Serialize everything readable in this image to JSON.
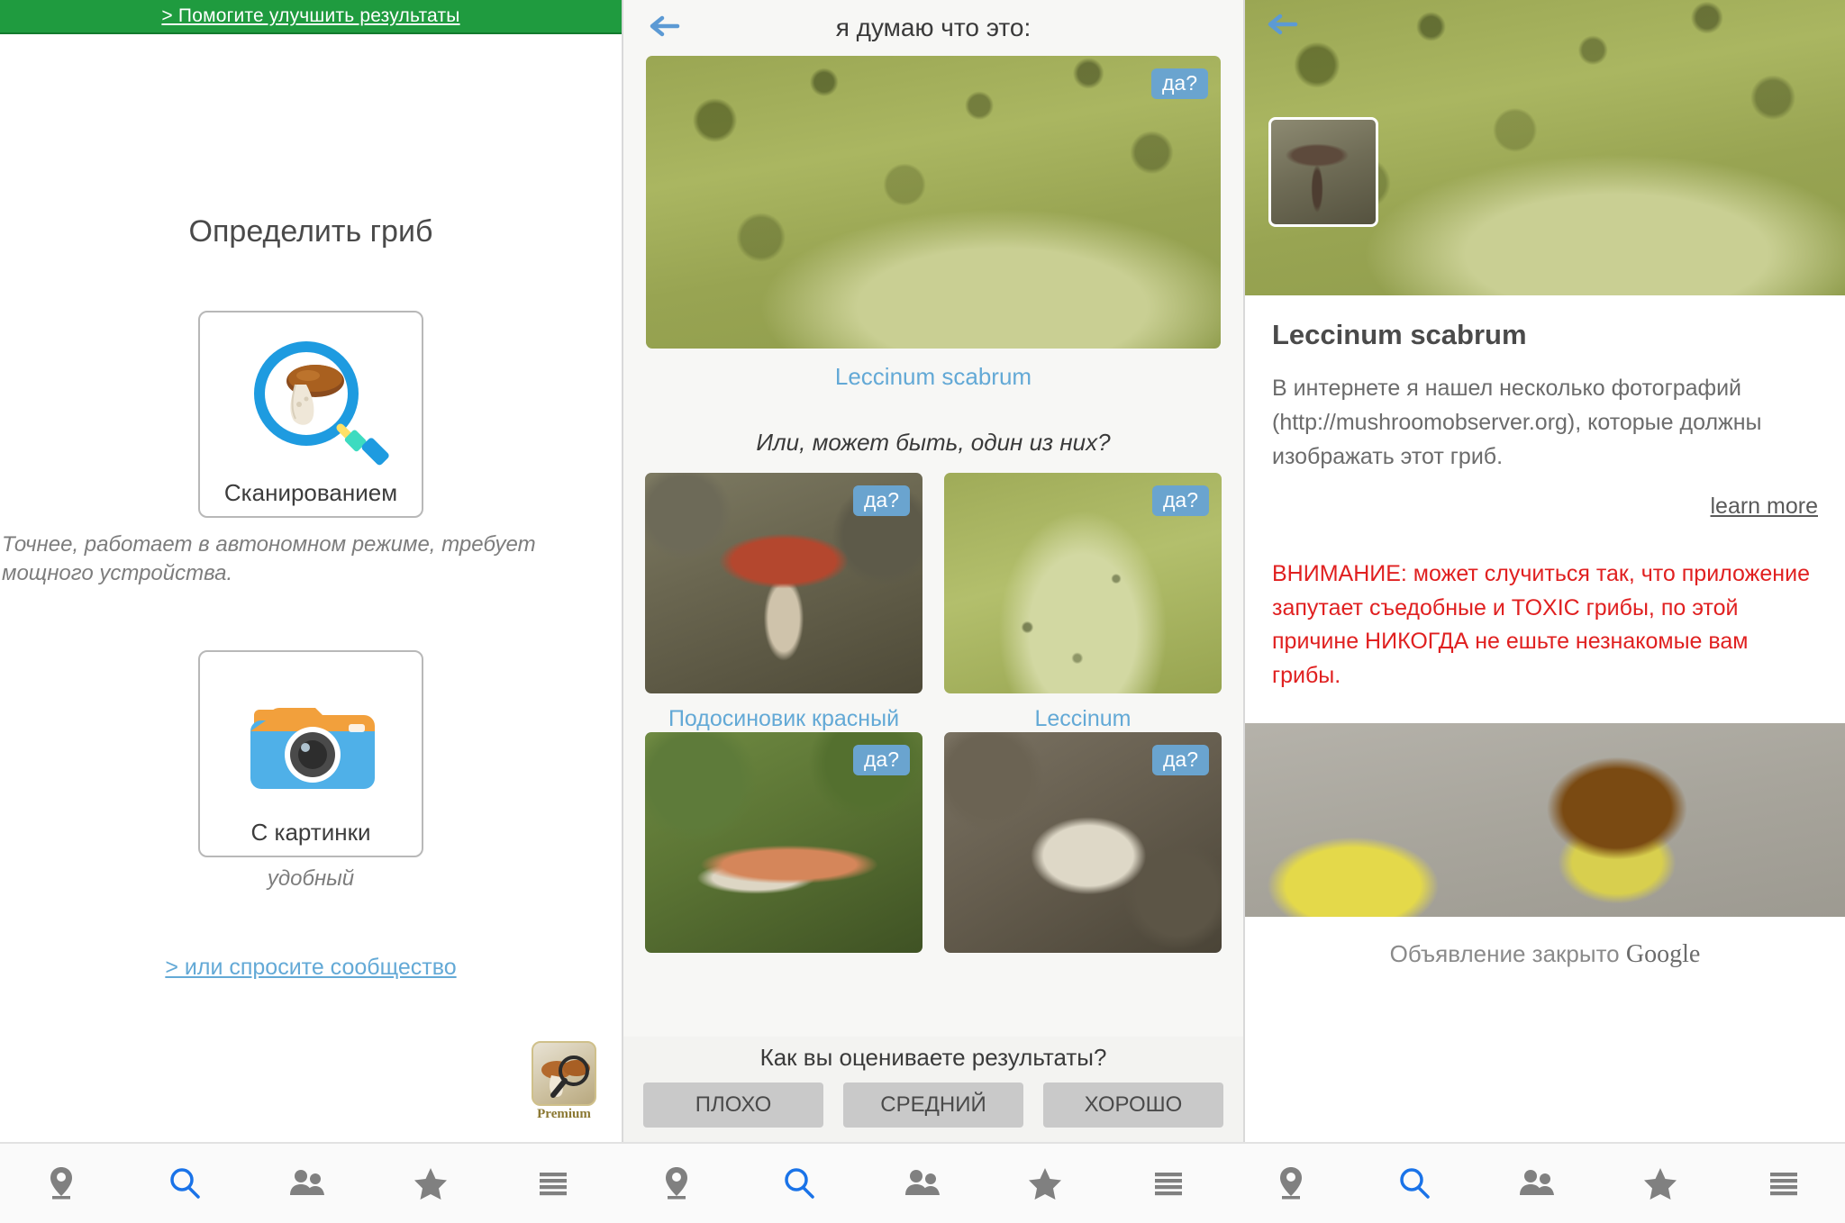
{
  "left": {
    "banner": {
      "text": "> Помогите улучшить результаты"
    },
    "title": "Определить гриб",
    "scan_card": {
      "label": "Сканированием",
      "icon": "mushroom-magnifier-icon"
    },
    "scan_note": "Точнее, работает в автономном режиме, требует мощного устройства.",
    "picture_card": {
      "label": "С картинки",
      "icon": "camera-icon"
    },
    "picture_note": "удобный",
    "community_link": "> или спросите сообщество",
    "premium": {
      "label": "Premium",
      "icon": "premium-app-icon"
    }
  },
  "middle": {
    "back_icon": "back-arrow-icon",
    "header_title": "я думаю что это:",
    "primary": {
      "caption": "Leccinum scabrum",
      "badge": "да?"
    },
    "alt_question": "Или, может быть, один из них?",
    "alternatives": [
      {
        "caption": "Подосиновик красный",
        "badge": "да?"
      },
      {
        "caption": "Leccinum",
        "badge": "да?"
      },
      {
        "caption": "",
        "badge": "да?"
      },
      {
        "caption": "",
        "badge": "да?"
      }
    ],
    "rating": {
      "question": "Как вы оцениваете результаты?",
      "buttons": [
        "ПЛОХО",
        "СРЕДНИЙ",
        "ХОРОШО"
      ]
    }
  },
  "right": {
    "back_icon": "back-arrow-icon",
    "species_name": "Leccinum scabrum",
    "description": "В интернете я нашел несколько фотографий (http://mushroomobserver.org), которые должны изображать этот гриб.",
    "learn_more": "learn more",
    "warning": "ВНИМАНИЕ: может случиться так, что приложение запутает съедобные и TOXIC грибы, по этой причине НИКОГДА не ешьте незнакомые вам грибы.",
    "ad_footer_text": "Объявление закрыто",
    "ad_footer_brand": "Google"
  },
  "bottom_nav": {
    "items": [
      {
        "icon": "location-pin-icon",
        "active": false
      },
      {
        "icon": "search-icon",
        "active": true
      },
      {
        "icon": "people-icon",
        "active": false
      },
      {
        "icon": "star-icon",
        "active": false
      },
      {
        "icon": "menu-icon",
        "active": false
      }
    ]
  },
  "colors": {
    "banner_green": "#1f9b3f",
    "link_blue": "#63a9d6",
    "badge_blue": "#6aa4cf",
    "warning_red": "#e02020",
    "nav_active": "#1a73e8",
    "nav_inactive": "#808080"
  }
}
